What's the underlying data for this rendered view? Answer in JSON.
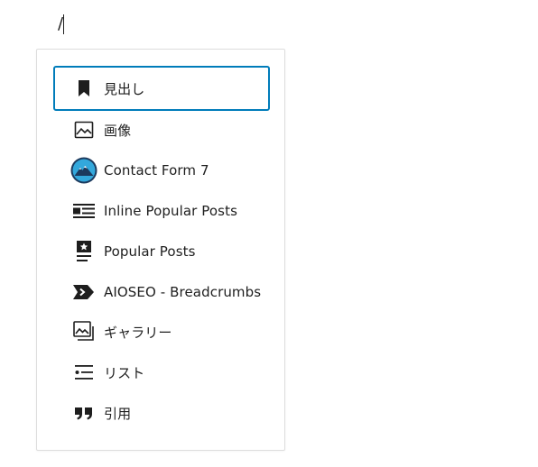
{
  "editor": {
    "typed_text": "/"
  },
  "inserter": {
    "items": [
      {
        "label": "見出し",
        "icon": "bookmark-icon"
      },
      {
        "label": "画像",
        "icon": "image-icon"
      },
      {
        "label": "Contact Form 7",
        "icon": "contact-form-7-icon"
      },
      {
        "label": "Inline Popular Posts",
        "icon": "inline-posts-icon"
      },
      {
        "label": "Popular Posts",
        "icon": "popular-posts-icon"
      },
      {
        "label": "AIOSEO - Breadcrumbs",
        "icon": "breadcrumb-tag-icon"
      },
      {
        "label": "ギャラリー",
        "icon": "gallery-icon"
      },
      {
        "label": "リスト",
        "icon": "list-icon"
      },
      {
        "label": "引用",
        "icon": "quote-icon"
      }
    ]
  },
  "colors": {
    "accent": "#007cba",
    "text": "#1e1e1e",
    "border": "#dddddd",
    "cf7_blue": "#33a8dc",
    "cf7_navy": "#1c3a5e"
  }
}
